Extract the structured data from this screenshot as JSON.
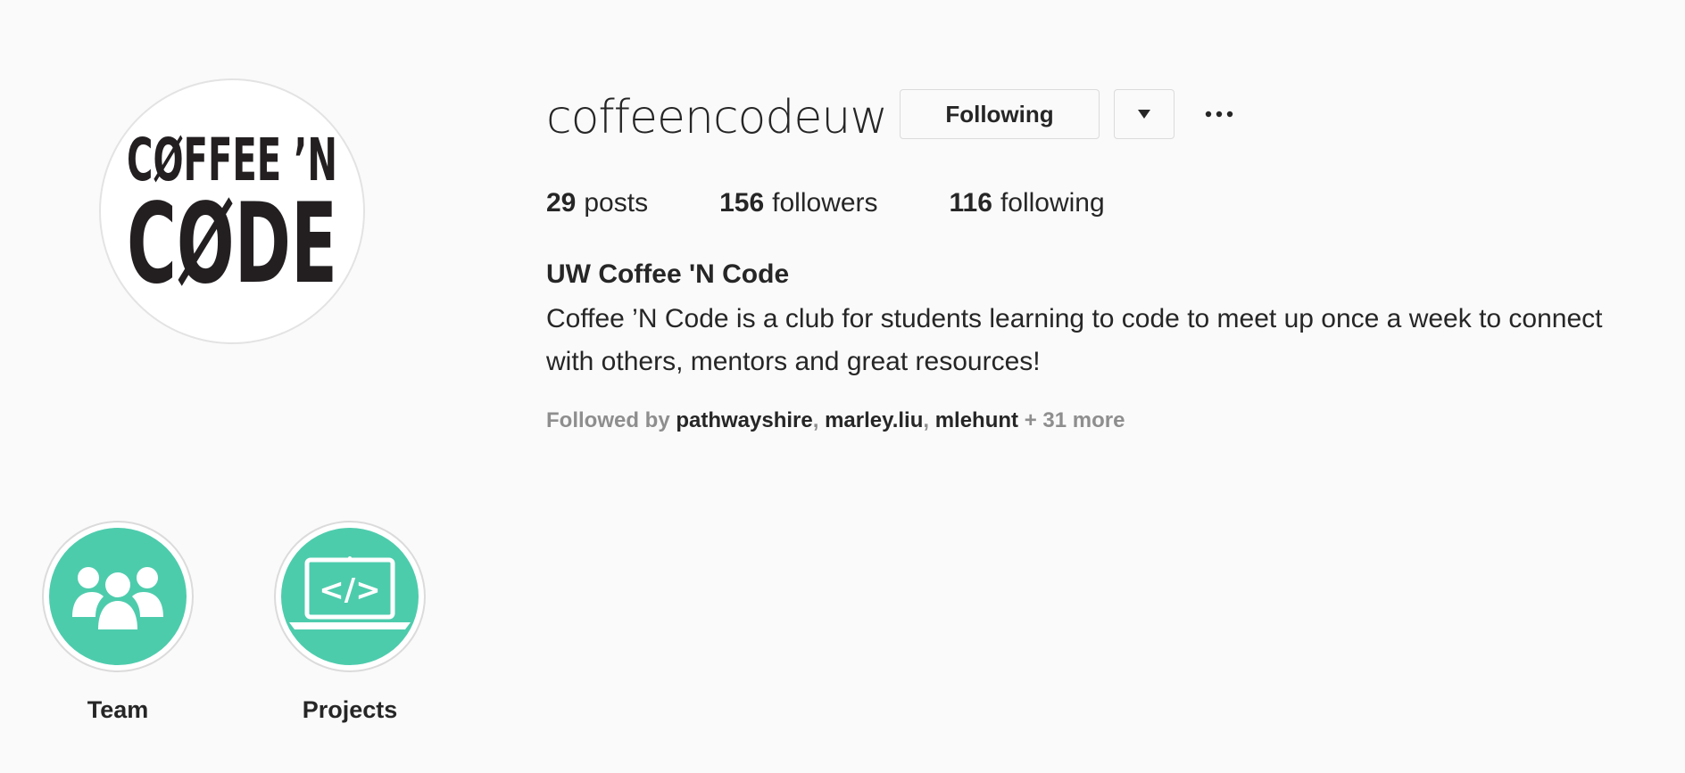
{
  "profile": {
    "username": "coffeencodeuw",
    "following_button_label": "Following",
    "avatar": {
      "line1": "CØFFEE ’N",
      "line2": "CØDE"
    },
    "stats": {
      "posts_count": "29",
      "posts_label": "posts",
      "followers_count": "156",
      "followers_label": "followers",
      "following_count": "116",
      "following_label": "following"
    },
    "full_name": "UW Coffee 'N Code",
    "bio": "Coffee ’N Code is a club for students learning to code to meet up once a week to connect with others, mentors and great resources!",
    "followed_by": {
      "prefix": "Followed by",
      "accounts": [
        "pathwayshire",
        "marley.liu",
        "mlehunt"
      ],
      "more": "+ 31 more"
    }
  },
  "highlights": [
    {
      "label": "Team",
      "icon": "people-icon"
    },
    {
      "label": "Projects",
      "icon": "laptop-code-icon"
    }
  ],
  "colors": {
    "background": "#fafafa",
    "highlight_fill": "#4dccac",
    "text": "#262626",
    "muted": "#8e8e8e",
    "border": "#dbdbdb"
  }
}
